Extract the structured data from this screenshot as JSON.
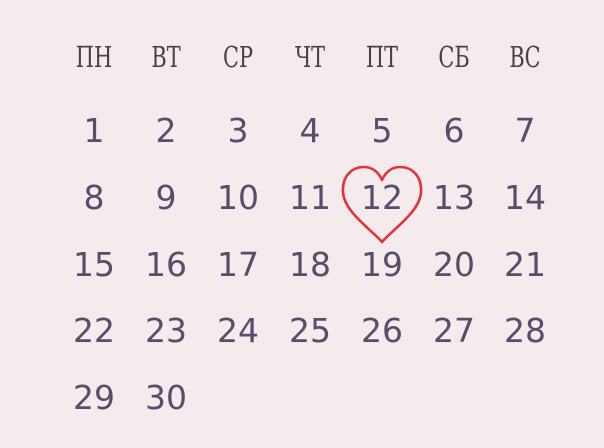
{
  "calendar": {
    "weekdays": [
      "ПН",
      "ВТ",
      "СР",
      "ЧТ",
      "ПТ",
      "СБ",
      "ВС"
    ],
    "weeks": [
      [
        "1",
        "2",
        "3",
        "4",
        "5",
        "6",
        "7"
      ],
      [
        "8",
        "9",
        "10",
        "11",
        "12",
        "13",
        "14"
      ],
      [
        "15",
        "16",
        "17",
        "18",
        "19",
        "20",
        "21"
      ],
      [
        "22",
        "23",
        "24",
        "25",
        "26",
        "27",
        "28"
      ],
      [
        "29",
        "30"
      ]
    ],
    "highlighted_day": "12",
    "highlight_icon": "heart-icon",
    "colors": {
      "background": "#f4ecec",
      "weekday_text": "#4a4048",
      "day_text": "#5a4c6c",
      "heart_stroke": "#e0333c"
    }
  }
}
